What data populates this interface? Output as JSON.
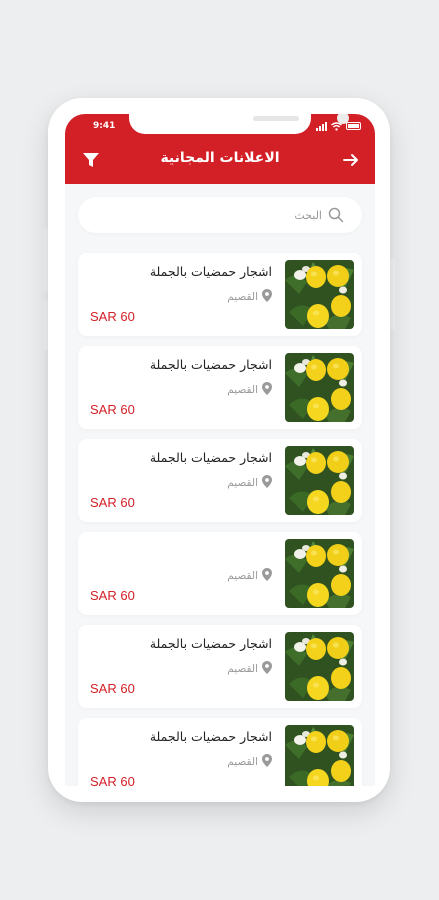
{
  "status_bar": {
    "time": "9:41"
  },
  "header": {
    "title": "الاعلانات المجانية",
    "filter_icon": "filter-icon",
    "back_icon": "arrow-right-icon"
  },
  "search": {
    "placeholder": "البحث",
    "value": ""
  },
  "colors": {
    "primary": "#d32027",
    "background": "#f6f7f9",
    "card": "#ffffff",
    "muted_text": "#9a9a9a"
  },
  "listings": [
    {
      "title": "اشجار حمضيات بالجملة",
      "location": "القصيم",
      "price": "SAR 60",
      "image": "lemon-tree-image"
    },
    {
      "title": "اشجار حمضيات بالجملة",
      "location": "القصيم",
      "price": "SAR 60",
      "image": "lemon-tree-image"
    },
    {
      "title": "اشجار حمضيات بالجملة",
      "location": "القصيم",
      "price": "SAR 60",
      "image": "lemon-tree-image"
    },
    {
      "title": "",
      "location": "القصيم",
      "price": "SAR 60",
      "image": "lemon-tree-image"
    },
    {
      "title": "اشجار حمضيات بالجملة",
      "location": "القصيم",
      "price": "SAR 60",
      "image": "lemon-tree-image"
    },
    {
      "title": "اشجار حمضيات بالجملة",
      "location": "القصيم",
      "price": "SAR 60",
      "image": "lemon-tree-image"
    }
  ]
}
